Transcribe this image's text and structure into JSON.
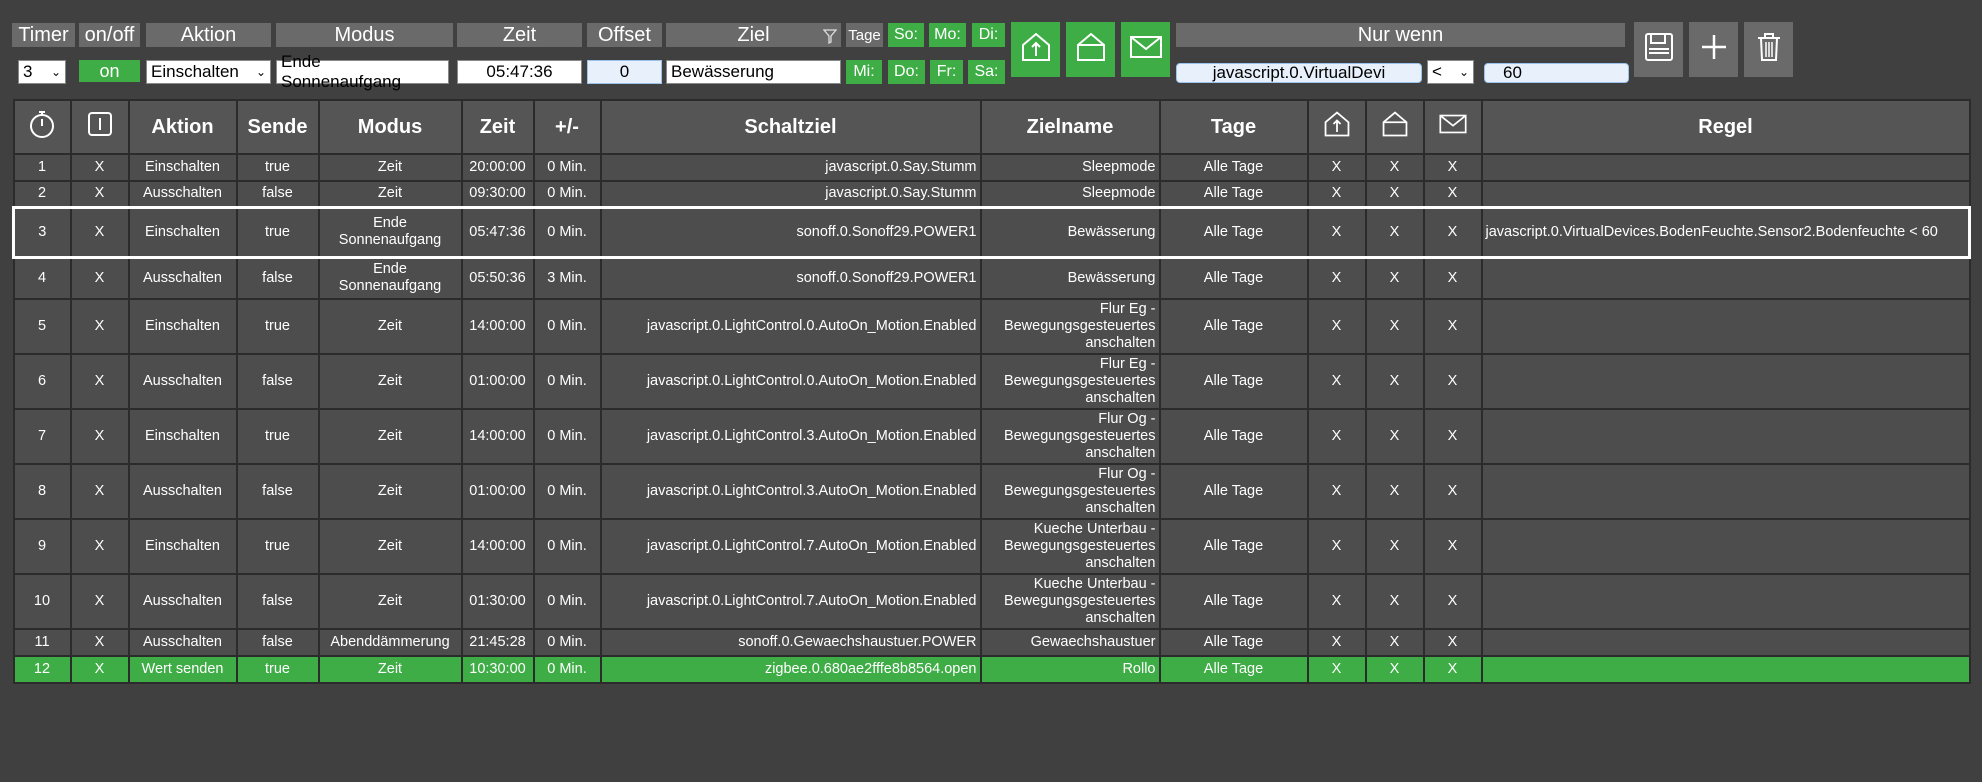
{
  "toolbar": {
    "labels": {
      "timer": "Timer",
      "onoff": "on/off",
      "aktion": "Aktion",
      "modus": "Modus",
      "zeit": "Zeit",
      "offset": "Offset",
      "ziel": "Ziel",
      "tage": "Tage",
      "nur_wenn": "Nur wenn"
    },
    "timer_select": "3",
    "onoff_button": "on",
    "aktion_select": "Einschalten",
    "modus_value": "Ende Sonnenaufgang",
    "zeit_value": "05:47:36",
    "offset_value": "0",
    "ziel_value": "Bewässerung",
    "days": [
      "So:",
      "Mo:",
      "Di:",
      "Mi:",
      "Do:",
      "Fr:",
      "Sa:"
    ],
    "condition_state": "javascript.0.VirtualDevi",
    "condition_operator": "<",
    "condition_value": "60"
  },
  "table": {
    "headers": [
      "Aktion",
      "Sende",
      "Modus",
      "Zeit",
      "+/-",
      "Schaltziel",
      "Zielname",
      "Tage",
      "Regel"
    ],
    "rows": [
      {
        "nr": "1",
        "en": "X",
        "aktion": "Einschalten",
        "sende": "true",
        "modus": "Zeit",
        "zeit": "20:00:00",
        "offset": "0 Min.",
        "schaltziel": "javascript.0.Say.Stumm",
        "zielname": "Sleepmode",
        "tage": "Alle Tage",
        "a": "X",
        "b": "X",
        "c": "X",
        "regel": ""
      },
      {
        "nr": "2",
        "en": "X",
        "aktion": "Ausschalten",
        "sende": "false",
        "modus": "Zeit",
        "zeit": "09:30:00",
        "offset": "0 Min.",
        "schaltziel": "javascript.0.Say.Stumm",
        "zielname": "Sleepmode",
        "tage": "Alle Tage",
        "a": "X",
        "b": "X",
        "c": "X",
        "regel": ""
      },
      {
        "nr": "3",
        "en": "X",
        "aktion": "Einschalten",
        "sende": "true",
        "modus": "Ende Sonnenaufgang",
        "zeit": "05:47:36",
        "offset": "0 Min.",
        "schaltziel": "sonoff.0.Sonoff29.POWER1",
        "zielname": "Bewässerung",
        "tage": "Alle Tage",
        "a": "X",
        "b": "X",
        "c": "X",
        "regel": "javascript.0.VirtualDevices.BodenFeuchte.Sensor2.Bodenfeuchte < 60"
      },
      {
        "nr": "4",
        "en": "X",
        "aktion": "Ausschalten",
        "sende": "false",
        "modus": "Ende Sonnenaufgang",
        "zeit": "05:50:36",
        "offset": "3 Min.",
        "schaltziel": "sonoff.0.Sonoff29.POWER1",
        "zielname": "Bewässerung",
        "tage": "Alle Tage",
        "a": "X",
        "b": "X",
        "c": "X",
        "regel": ""
      },
      {
        "nr": "5",
        "en": "X",
        "aktion": "Einschalten",
        "sende": "true",
        "modus": "Zeit",
        "zeit": "14:00:00",
        "offset": "0 Min.",
        "schaltziel": "javascript.0.LightControl.0.AutoOn_Motion.Enabled",
        "zielname": "Flur Eg - Bewegungsgesteuertes anschalten",
        "tage": "Alle Tage",
        "a": "X",
        "b": "X",
        "c": "X",
        "regel": ""
      },
      {
        "nr": "6",
        "en": "X",
        "aktion": "Ausschalten",
        "sende": "false",
        "modus": "Zeit",
        "zeit": "01:00:00",
        "offset": "0 Min.",
        "schaltziel": "javascript.0.LightControl.0.AutoOn_Motion.Enabled",
        "zielname": "Flur Eg - Bewegungsgesteuertes anschalten",
        "tage": "Alle Tage",
        "a": "X",
        "b": "X",
        "c": "X",
        "regel": ""
      },
      {
        "nr": "7",
        "en": "X",
        "aktion": "Einschalten",
        "sende": "true",
        "modus": "Zeit",
        "zeit": "14:00:00",
        "offset": "0 Min.",
        "schaltziel": "javascript.0.LightControl.3.AutoOn_Motion.Enabled",
        "zielname": "Flur Og - Bewegungsgesteuertes anschalten",
        "tage": "Alle Tage",
        "a": "X",
        "b": "X",
        "c": "X",
        "regel": ""
      },
      {
        "nr": "8",
        "en": "X",
        "aktion": "Ausschalten",
        "sende": "false",
        "modus": "Zeit",
        "zeit": "01:00:00",
        "offset": "0 Min.",
        "schaltziel": "javascript.0.LightControl.3.AutoOn_Motion.Enabled",
        "zielname": "Flur Og - Bewegungsgesteuertes anschalten",
        "tage": "Alle Tage",
        "a": "X",
        "b": "X",
        "c": "X",
        "regel": ""
      },
      {
        "nr": "9",
        "en": "X",
        "aktion": "Einschalten",
        "sende": "true",
        "modus": "Zeit",
        "zeit": "14:00:00",
        "offset": "0 Min.",
        "schaltziel": "javascript.0.LightControl.7.AutoOn_Motion.Enabled",
        "zielname": "Kueche Unterbau - Bewegungsgesteuertes anschalten",
        "tage": "Alle Tage",
        "a": "X",
        "b": "X",
        "c": "X",
        "regel": ""
      },
      {
        "nr": "10",
        "en": "X",
        "aktion": "Ausschalten",
        "sende": "false",
        "modus": "Zeit",
        "zeit": "01:30:00",
        "offset": "0 Min.",
        "schaltziel": "javascript.0.LightControl.7.AutoOn_Motion.Enabled",
        "zielname": "Kueche Unterbau - Bewegungsgesteuertes anschalten",
        "tage": "Alle Tage",
        "a": "X",
        "b": "X",
        "c": "X",
        "regel": ""
      },
      {
        "nr": "11",
        "en": "X",
        "aktion": "Ausschalten",
        "sende": "false",
        "modus": "Abenddämmerung",
        "zeit": "21:45:28",
        "offset": "0 Min.",
        "schaltziel": "sonoff.0.Gewaechshaustuer.POWER",
        "zielname": "Gewaechshaustuer",
        "tage": "Alle Tage",
        "a": "X",
        "b": "X",
        "c": "X",
        "regel": ""
      },
      {
        "nr": "12",
        "en": "X",
        "aktion": "Wert senden",
        "sende": "true",
        "modus": "Zeit",
        "zeit": "10:30:00",
        "offset": "0 Min.",
        "schaltziel": "zigbee.0.680ae2fffe8b8564.open",
        "zielname": "Rollo",
        "tage": "Alle Tage",
        "a": "X",
        "b": "X",
        "c": "X",
        "regel": ""
      }
    ]
  },
  "colors": {
    "accent_green": "#3fad46",
    "background": "#404040",
    "header": "#555555"
  }
}
